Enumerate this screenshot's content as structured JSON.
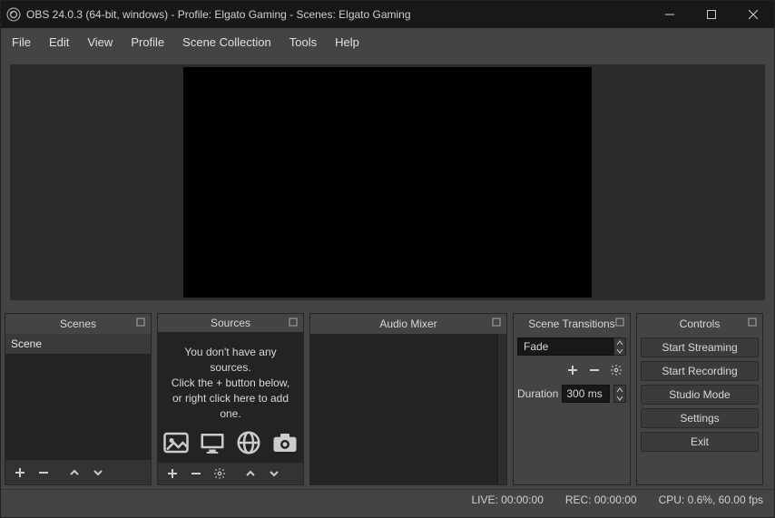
{
  "window": {
    "title": "OBS 24.0.3 (64-bit, windows) - Profile: Elgato Gaming - Scenes: Elgato Gaming"
  },
  "menu": {
    "file": "File",
    "edit": "Edit",
    "view": "View",
    "profile": "Profile",
    "scene_collection": "Scene Collection",
    "tools": "Tools",
    "help": "Help"
  },
  "docks": {
    "scenes": {
      "title": "Scenes",
      "items": [
        "Scene"
      ]
    },
    "sources": {
      "title": "Sources",
      "empty_line1": "You don't have any sources.",
      "empty_line2": "Click the + button below,",
      "empty_line3": "or right click here to add one."
    },
    "audio": {
      "title": "Audio Mixer"
    },
    "transitions": {
      "title": "Scene Transitions",
      "selected": "Fade",
      "duration_label": "Duration",
      "duration_value": "300 ms"
    },
    "controls": {
      "title": "Controls",
      "start_streaming": "Start Streaming",
      "start_recording": "Start Recording",
      "studio_mode": "Studio Mode",
      "settings": "Settings",
      "exit": "Exit"
    }
  },
  "status": {
    "live": "LIVE: 00:00:00",
    "rec": "REC: 00:00:00",
    "cpu": "CPU: 0.6%, 60.00 fps"
  }
}
